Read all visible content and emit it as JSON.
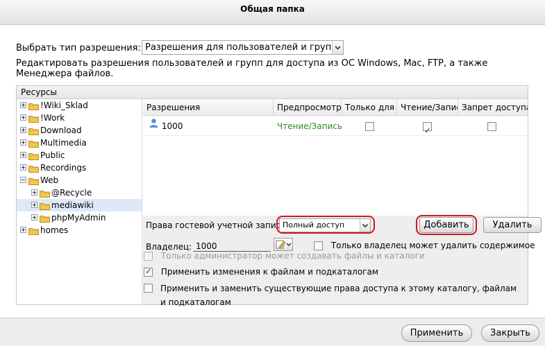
{
  "window": {
    "title": "Общая папка"
  },
  "permission_type": {
    "label": "Выбрать тип разрешения:",
    "selected": "Разрешения для пользователей и групп"
  },
  "description": "Редактировать разрешения пользователей и групп для доступа из ОС Windows, Mac, FTP, а также Менеджера файлов.",
  "resources": {
    "header": "Ресурсы",
    "tree": [
      {
        "label": "!Wiki_Sklad",
        "level": 0,
        "expander": "plus",
        "selected": false
      },
      {
        "label": "!Work",
        "level": 0,
        "expander": "plus",
        "selected": false
      },
      {
        "label": "Download",
        "level": 0,
        "expander": "plus",
        "selected": false
      },
      {
        "label": "Multimedia",
        "level": 0,
        "expander": "plus",
        "selected": false
      },
      {
        "label": "Public",
        "level": 0,
        "expander": "plus",
        "selected": false
      },
      {
        "label": "Recordings",
        "level": 0,
        "expander": "plus",
        "selected": false
      },
      {
        "label": "Web",
        "level": 0,
        "expander": "minus",
        "selected": false
      },
      {
        "label": "@Recycle",
        "level": 1,
        "expander": "plus",
        "selected": false
      },
      {
        "label": "mediawiki",
        "level": 1,
        "expander": "plus",
        "selected": true
      },
      {
        "label": "phpMyAdmin",
        "level": 1,
        "expander": "plus",
        "selected": false
      },
      {
        "label": "homes",
        "level": 0,
        "expander": "plus",
        "selected": false
      }
    ]
  },
  "permissions_grid": {
    "columns": [
      "Разрешения",
      "Предпросмотр",
      "Только для чтения",
      "Чтение/Запись",
      "Запрет доступа"
    ],
    "rows": [
      {
        "user": "1000",
        "preview": "Чтение/Запись",
        "read_only": false,
        "read_write": true,
        "deny": false
      }
    ]
  },
  "guest": {
    "label": "Права гостевой учетной записи:",
    "selected": "Полный доступ"
  },
  "buttons": {
    "add": "Добавить",
    "remove": "Удалить",
    "apply": "Применить",
    "close": "Закрыть"
  },
  "owner": {
    "label": "Владелец:",
    "value": "1000",
    "only_owner_delete": "Только владелец может удалить содержимое"
  },
  "options": {
    "admin_only_create": "Только администратор может создавать файлы и каталоги",
    "apply_subfolders": "Применить изменения к файлам и подкаталогам",
    "apply_replace": "Применить и заменить существующие права доступа к этому каталогу, файлам и подкаталогам"
  },
  "colors": {
    "preview_text": "#2e8b1e",
    "highlight_outline": "#d1171f",
    "selected_row": "#dfe8f6",
    "folder": "#f3c74e"
  }
}
